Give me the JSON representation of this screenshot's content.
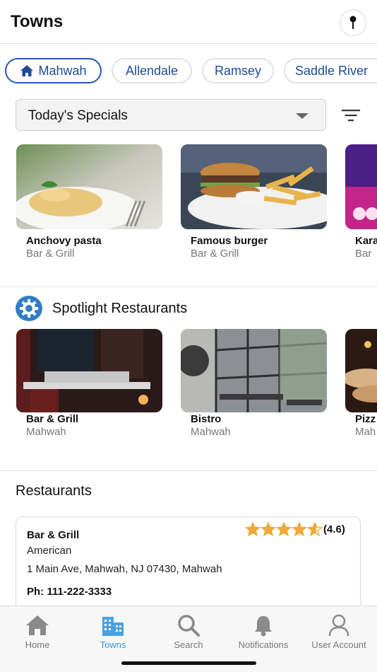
{
  "header": {
    "title": "Towns"
  },
  "chips": [
    {
      "label": "Mahwah",
      "active": true
    },
    {
      "label": "Allendale",
      "active": false
    },
    {
      "label": "Ramsey",
      "active": false
    },
    {
      "label": "Saddle River",
      "active": false
    }
  ],
  "specials": {
    "selected": "Today's Specials",
    "items": [
      {
        "name": "Anchovy pasta",
        "sub": "Bar & Grill"
      },
      {
        "name": "Famous burger",
        "sub": "Bar & Grill"
      },
      {
        "name": "Kara",
        "sub": "Bar"
      }
    ]
  },
  "spotlight": {
    "title": "Spotlight Restaurants",
    "items": [
      {
        "name": "Bar & Grill",
        "sub": "Mahwah"
      },
      {
        "name": "Bistro",
        "sub": "Mahwah"
      },
      {
        "name": "Pizz",
        "sub": "Mah"
      }
    ]
  },
  "restaurants": {
    "title": "Restaurants",
    "first": {
      "name": "Bar & Grill",
      "cuisine": "American",
      "address": "1 Main Ave, Mahwah, NJ 07430, Mahwah",
      "phone": "Ph: 111-222-3333",
      "rating_text": "(4.6)",
      "rating_value": 4.6
    }
  },
  "tabs": [
    {
      "label": "Home",
      "icon": "home-icon"
    },
    {
      "label": "Towns",
      "icon": "buildings-icon",
      "active": true
    },
    {
      "label": "Search",
      "icon": "search-icon"
    },
    {
      "label": "Notifications",
      "icon": "bell-icon"
    },
    {
      "label": "User Account",
      "icon": "user-icon"
    }
  ],
  "colors": {
    "accent": "#2656b5",
    "chip_text": "#1e4b97",
    "tab_active": "#3a95dd",
    "star": "#f0a93a"
  }
}
